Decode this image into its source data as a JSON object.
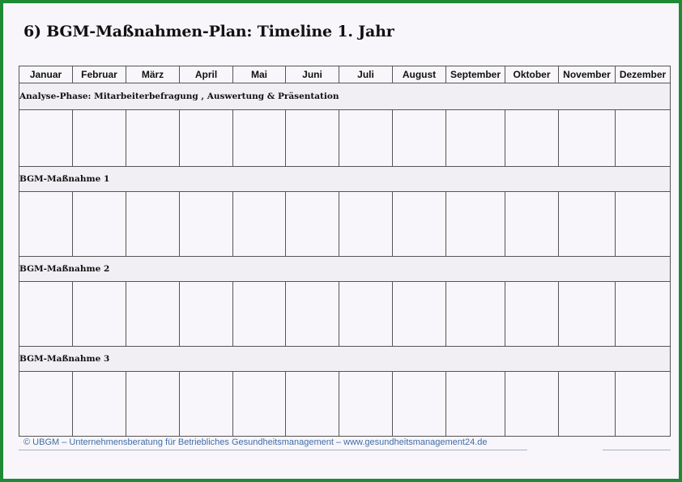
{
  "document": {
    "title": "6) BGM-Maßnahmen-Plan: Timeline 1. Jahr"
  },
  "table": {
    "months": [
      "Januar",
      "Februar",
      "März",
      "April",
      "Mai",
      "Juni",
      "Juli",
      "August",
      "September",
      "Oktober",
      "November",
      "Dezember"
    ],
    "sections": [
      {
        "label": "Analyse-Phase:  Mitarbeiterbefragung , Auswertung & Präsentation"
      },
      {
        "label": "BGM-Maßnahme 1"
      },
      {
        "label": "BGM-Maßnahme 2"
      },
      {
        "label": "BGM-Maßnahme 3"
      }
    ]
  },
  "footer": {
    "text": "© UBGM – Unternehmensberatung für Betriebliches Gesundheitsmanagement – www.gesundheitsmanagement24.de"
  }
}
